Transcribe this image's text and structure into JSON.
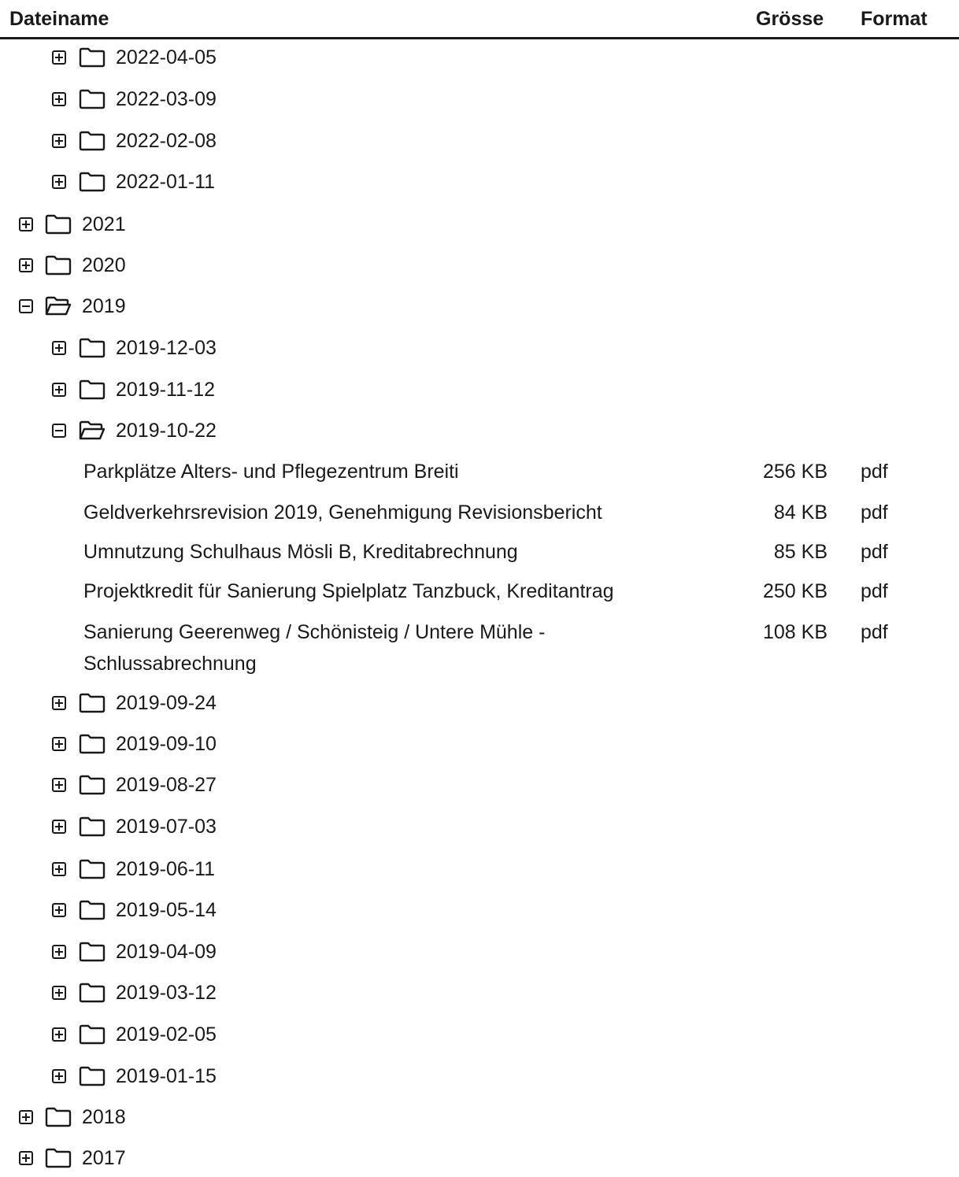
{
  "header": {
    "name": "Dateiname",
    "size": "Grösse",
    "format": "Format"
  },
  "rows": [
    {
      "kind": "folder",
      "level": 1,
      "label": "2022-04-05",
      "expanded": false
    },
    {
      "kind": "folder",
      "level": 1,
      "label": "2022-03-09",
      "expanded": false
    },
    {
      "kind": "folder",
      "level": 1,
      "label": "2022-02-08",
      "expanded": false
    },
    {
      "kind": "folder",
      "level": 1,
      "label": "2022-01-11",
      "expanded": false
    },
    {
      "kind": "folder",
      "level": 0,
      "label": "2021",
      "expanded": false
    },
    {
      "kind": "folder",
      "level": 0,
      "label": "2020",
      "expanded": false
    },
    {
      "kind": "folder",
      "level": 0,
      "label": "2019",
      "expanded": true
    },
    {
      "kind": "folder",
      "level": 1,
      "label": "2019-12-03",
      "expanded": false
    },
    {
      "kind": "folder",
      "level": 1,
      "label": "2019-11-12",
      "expanded": false
    },
    {
      "kind": "folder",
      "level": 1,
      "label": "2019-10-22",
      "expanded": true
    },
    {
      "kind": "file",
      "label": "Parkplätze Alters- und Pflegezentrum Breiti",
      "size": "256 KB",
      "format": "pdf"
    },
    {
      "kind": "file",
      "label": "Geldverkehrsrevision 2019, Genehmigung Revisionsbericht",
      "size": "84 KB",
      "format": "pdf"
    },
    {
      "kind": "file",
      "label": "Umnutzung Schulhaus Mösli B, Kreditabrechnung",
      "size": "85 KB",
      "format": "pdf"
    },
    {
      "kind": "file",
      "label": "Projektkredit für Sanierung Spielplatz Tanzbuck, Kreditantrag",
      "size": "250 KB",
      "format": "pdf"
    },
    {
      "kind": "file",
      "label": "Sanierung Geerenweg / Schönisteig / Untere Mühle - Schlussabrechnung",
      "size": "108 KB",
      "format": "pdf"
    },
    {
      "kind": "folder",
      "level": 1,
      "label": "2019-09-24",
      "expanded": false
    },
    {
      "kind": "folder",
      "level": 1,
      "label": "2019-09-10",
      "expanded": false
    },
    {
      "kind": "folder",
      "level": 1,
      "label": "2019-08-27",
      "expanded": false
    },
    {
      "kind": "folder",
      "level": 1,
      "label": "2019-07-03",
      "expanded": false
    },
    {
      "kind": "folder",
      "level": 1,
      "label": "2019-06-11",
      "expanded": false
    },
    {
      "kind": "folder",
      "level": 1,
      "label": "2019-05-14",
      "expanded": false
    },
    {
      "kind": "folder",
      "level": 1,
      "label": "2019-04-09",
      "expanded": false
    },
    {
      "kind": "folder",
      "level": 1,
      "label": "2019-03-12",
      "expanded": false
    },
    {
      "kind": "folder",
      "level": 1,
      "label": "2019-02-05",
      "expanded": false
    },
    {
      "kind": "folder",
      "level": 1,
      "label": "2019-01-15",
      "expanded": false
    },
    {
      "kind": "folder",
      "level": 0,
      "label": "2018",
      "expanded": false
    },
    {
      "kind": "folder",
      "level": 0,
      "label": "2017",
      "expanded": false
    }
  ]
}
